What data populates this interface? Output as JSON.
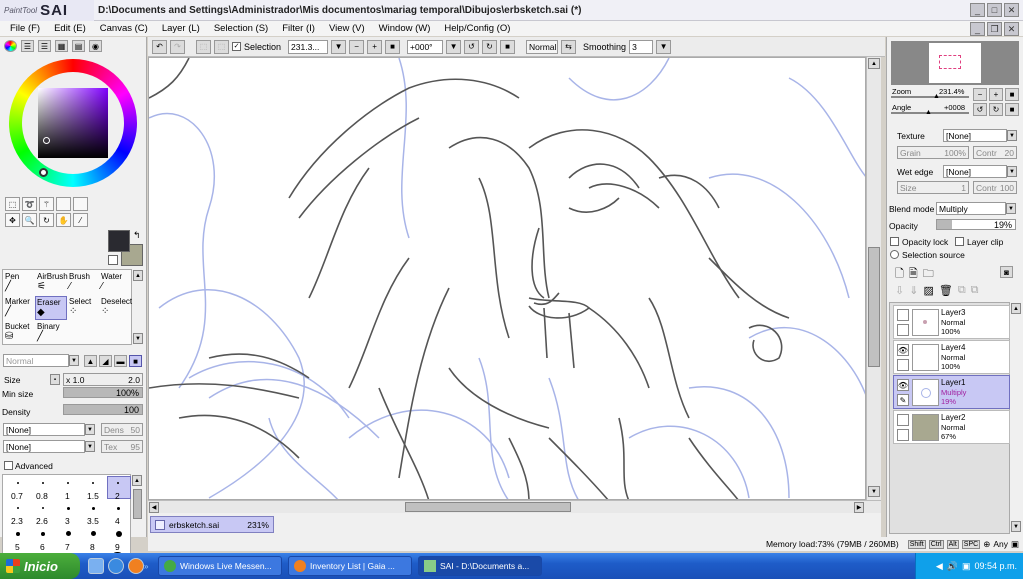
{
  "app": {
    "logo_small": "PaintTool",
    "logo_big": "SAI",
    "window_title": "D:\\Documents and Settings\\Administrador\\Mis documentos\\mariag temporal\\Dibujos\\erbsketch.sai (*)"
  },
  "menu": [
    "File (F)",
    "Edit (E)",
    "Canvas (C)",
    "Layer (L)",
    "Selection (S)",
    "Filter (I)",
    "View (V)",
    "Window (W)",
    "Help/Config (O)"
  ],
  "toolbar": {
    "selection_label": "Selection",
    "zoom_value": "231.3...",
    "rotation_value": "+000°",
    "mode_value": "Normal",
    "smoothing_label": "Smoothing",
    "smoothing_value": "3"
  },
  "tools": {
    "brushes": [
      "Pen",
      "AirBrush",
      "Brush",
      "Water",
      "Marker",
      "Eraser",
      "Select",
      "Deselect",
      "Bucket",
      "Binary"
    ],
    "selected_brush": "Eraser",
    "blend_mode": "Normal",
    "size_label": "Size",
    "size_multiplier": "x 1.0",
    "size_value": "2.0",
    "min_size_label": "Min size",
    "min_size_value": "100%",
    "min_size_fraction": 1.0,
    "density_label": "Density",
    "density_value": "100",
    "density_fraction": 1.0,
    "texture1": "[None]",
    "texture1_amount_label": "Dens",
    "texture1_amount": "50",
    "texture2": "[None]",
    "texture2_amount_label": "Tex",
    "texture2_amount": "95",
    "advanced_label": "Advanced",
    "sizes_row1": [
      "0.7",
      "0.8",
      "1",
      "1.5",
      "2"
    ],
    "sizes_row2": [
      "2.3",
      "2.6",
      "3",
      "3.5",
      "4"
    ],
    "sizes_row3": [
      "5",
      "6",
      "7",
      "8",
      "9"
    ],
    "selected_size": "2"
  },
  "document_tab": {
    "name": "erbsketch.sai",
    "zoom": "231%"
  },
  "navigator": {
    "zoom_label": "Zoom",
    "zoom_value": "231.4%",
    "angle_label": "Angle",
    "angle_value": "+0008"
  },
  "layer_props": {
    "texture_label": "Texture",
    "texture_value": "[None]",
    "grain_label": "Grain",
    "grain_value": "100%",
    "contr_label": "Contr",
    "contr_value": "20",
    "wet_edge_label": "Wet edge",
    "wet_edge_value": "[None]",
    "size_label": "Size",
    "size_value": "1",
    "contr2_value": "100",
    "blend_mode_label": "Blend mode",
    "blend_mode_value": "Multiply",
    "opacity_label": "Opacity",
    "opacity_value": "19%",
    "opacity_fraction": 0.19,
    "opacity_lock_label": "Opacity lock",
    "layer_clip_label": "Layer clip",
    "selection_source_label": "Selection source"
  },
  "layers": [
    {
      "name": "Layer3",
      "mode": "Normal",
      "opacity": "100%",
      "visible": false,
      "selected": false
    },
    {
      "name": "Layer4",
      "mode": "Normal",
      "opacity": "100%",
      "visible": true,
      "selected": false
    },
    {
      "name": "Layer1",
      "mode": "Multiply",
      "opacity": "19%",
      "visible": true,
      "selected": true
    },
    {
      "name": "Layer2",
      "mode": "Normal",
      "opacity": "67%",
      "visible": false,
      "selected": false
    }
  ],
  "status": {
    "memory": "Memory load:73% (79MB / 260MB)",
    "keys": [
      "Shift",
      "Ctrl",
      "Alt",
      "SPC"
    ],
    "any_label": "Any"
  },
  "taskbar": {
    "start_label": "Inicio",
    "tasks": [
      "Windows Live Messen...",
      "Inventory List | Gaia ...",
      "SAI - D:\\Documents a..."
    ],
    "active_task": 2,
    "clock": "09:54 p.m."
  },
  "colors": {
    "selected_blue": "#c8c8f4",
    "taskbar_blue": "#1e5cc8",
    "primary_color": "#2a2a30",
    "secondary_color": "#a8a890"
  }
}
